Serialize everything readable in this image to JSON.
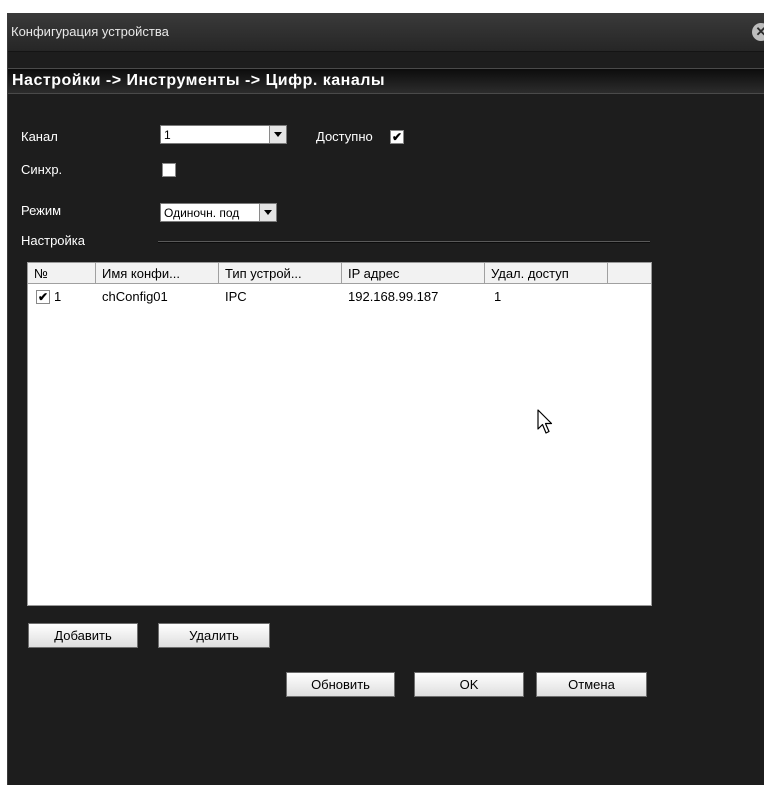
{
  "window": {
    "title": "Конфигурация устройства"
  },
  "breadcrumb": "Настройки -> Инструменты -> Цифр. каналы",
  "form": {
    "channel_label": "Канал",
    "channel_value": "1",
    "available_label": "Доступно",
    "available_checked": true,
    "sync_label": "Синхр.",
    "sync_checked": false,
    "mode_label": "Режим",
    "mode_value": "Одиночн. под",
    "settings_label": "Настройка"
  },
  "table": {
    "columns": [
      "№",
      "Имя конфи...",
      "Тип устрой...",
      "IP адрес",
      "Удал. доступ"
    ],
    "rows": [
      {
        "checked": true,
        "num": "1",
        "name": "chConfig01",
        "type": "IPC",
        "ip": "192.168.99.187",
        "remote": "1"
      }
    ]
  },
  "buttons": {
    "add": "Добавить",
    "delete": "Удалить",
    "refresh": "Обновить",
    "ok": "OK",
    "cancel": "Отмена"
  },
  "icons": {
    "close": "close-icon",
    "cursor": "mouse-pointer-icon"
  }
}
